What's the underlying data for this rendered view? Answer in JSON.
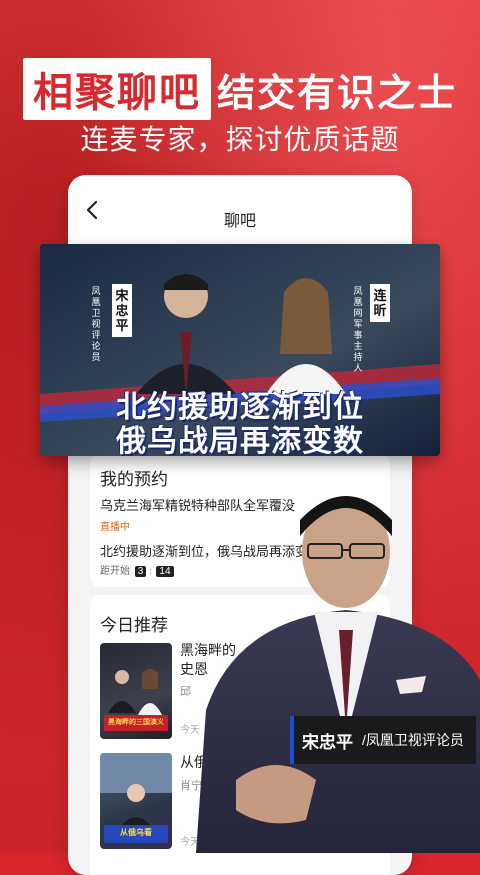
{
  "banner": {
    "title_highlight": "相聚聊吧",
    "title_rest": "结交有识之士",
    "subtitle": "连麦专家，探讨优质话题"
  },
  "app": {
    "back_icon": "chevron-left-icon",
    "page_title": "聊吧"
  },
  "video": {
    "guest1_name": "宋忠平",
    "guest1_role": "凤凰卫视评论员",
    "guest2_name": "连昕",
    "guest2_role": "凤凰网军事主持人",
    "headline_line1": "北约援助逐渐到位",
    "headline_line2": "俄乌战局再添变数"
  },
  "reservations": {
    "section_title": "我的预约",
    "items": [
      {
        "title": "乌克兰海军精锐特种部队全军覆没",
        "status": "直播中"
      },
      {
        "title": "北约援助逐渐到位，俄乌战局再添变数",
        "countdown_label": "距开始",
        "countdown_h": "3",
        "countdown_m": "14"
      }
    ]
  },
  "today": {
    "section_title": "今日推荐",
    "items": [
      {
        "title_line1": "黑海畔的",
        "title_line2": "史恩",
        "author": "邱",
        "time": "今天"
      },
      {
        "title_line1": "从俄",
        "title_line2": "看",
        "author": "肖宁",
        "time": "今天 20:00"
      }
    ]
  },
  "thumb1": {
    "badge": "黑海畔的三国演义"
  },
  "thumb2": {
    "badge": "从俄乌看"
  },
  "caption": {
    "name": "宋忠平",
    "title": "/凤凰卫视评论员"
  },
  "colors": {
    "brand_red": "#d62a2f",
    "live_orange": "#e8611a",
    "caption_blue": "#1a4fd6"
  }
}
